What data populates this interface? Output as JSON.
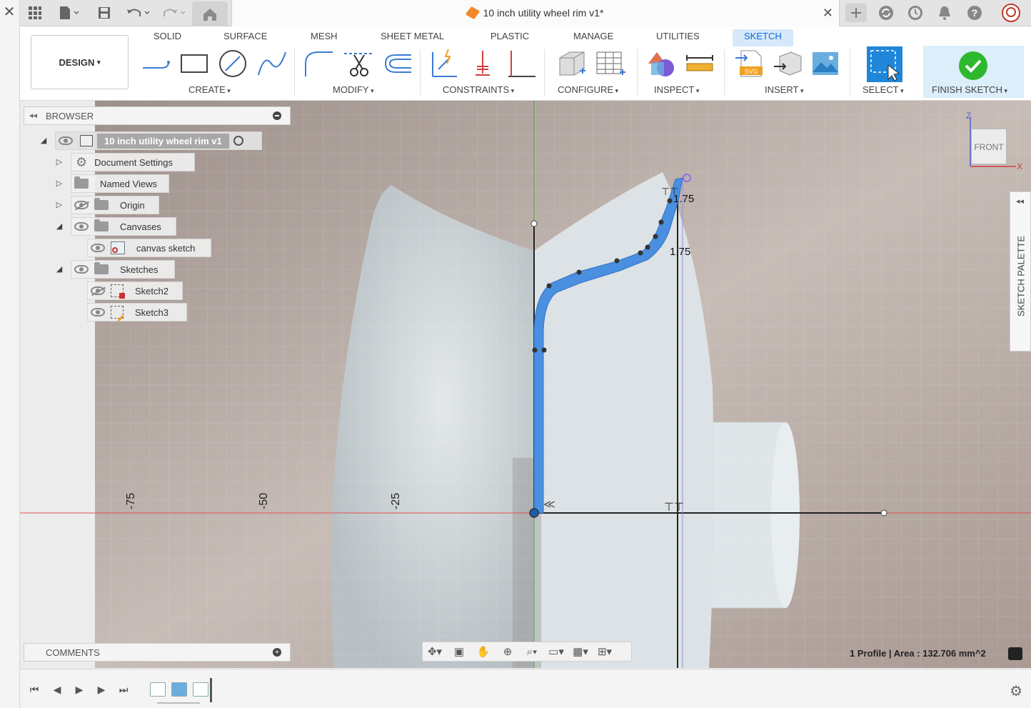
{
  "title_bar": {
    "document_title": "10 inch utility wheel rim v1*"
  },
  "toolbar": {
    "workspace_label": "DESIGN",
    "tabs": [
      "SOLID",
      "SURFACE",
      "MESH",
      "SHEET METAL",
      "PLASTIC",
      "MANAGE",
      "UTILITIES",
      "SKETCH"
    ],
    "active_tab": "SKETCH",
    "groups": {
      "create": "CREATE",
      "modify": "MODIFY",
      "constraints": "CONSTRAINTS",
      "configure": "CONFIGURE",
      "inspect": "INSPECT",
      "insert": "INSERT",
      "select": "SELECT",
      "finish": "FINISH SKETCH"
    }
  },
  "browser": {
    "label": "BROWSER",
    "root": "10 inch utility wheel rim v1",
    "items": [
      {
        "label": "Document Settings"
      },
      {
        "label": "Named Views"
      },
      {
        "label": "Origin"
      },
      {
        "label": "Canvases"
      },
      {
        "label": "canvas sketch"
      },
      {
        "label": "Sketches"
      },
      {
        "label": "Sketch2"
      },
      {
        "label": "Sketch3"
      }
    ]
  },
  "comments": {
    "label": "COMMENTS"
  },
  "viewport": {
    "ruler_labels": [
      "-75",
      "-50",
      "-25"
    ],
    "dimension_labels": [
      "1.75",
      "1.75"
    ],
    "view_cube_face": "FRONT",
    "axis_z": "Z",
    "axis_x": "X"
  },
  "sketch_palette": {
    "label": "SKETCH PALETTE"
  },
  "status": {
    "text": "1 Profile | Area : 132.706 mm^2"
  },
  "colors": {
    "accent": "#0c6ad6",
    "sketch_profile": "#4a8fe0",
    "finish_check": "#2eb82e",
    "red_axis": "#e05050",
    "green_axis": "#40b040"
  }
}
